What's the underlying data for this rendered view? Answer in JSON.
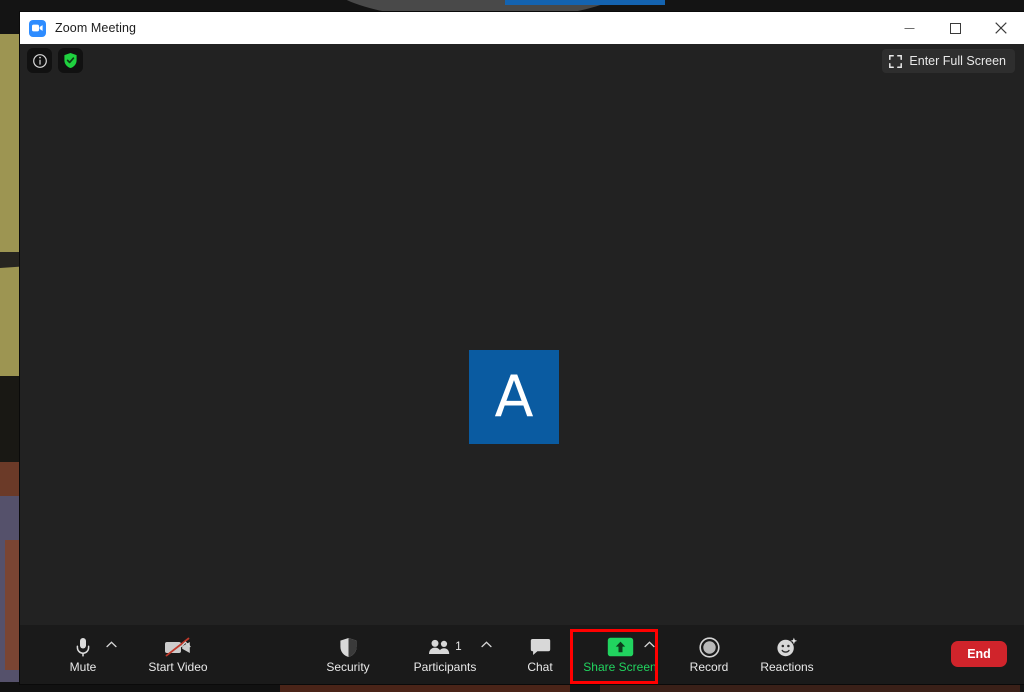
{
  "window": {
    "title": "Zoom Meeting",
    "logo_icon": "zoom-camera-icon",
    "controls": {
      "minimize_icon": "minimize-icon",
      "maximize_icon": "maximize-icon",
      "close_icon": "close-icon"
    }
  },
  "stage": {
    "info_icon": "info-circle-icon",
    "encryption_icon": "green-shield-check-icon",
    "full_screen": {
      "label": "Enter Full Screen",
      "icon": "expand-corners-icon"
    },
    "participant_tile": {
      "initial": "A",
      "background_color": "#0a5ba1"
    },
    "redacted_label": ""
  },
  "toolbar": {
    "items": [
      {
        "id": "mute",
        "label": "Mute",
        "icon": "microphone-icon",
        "has_caret": true,
        "state": "unmuted"
      },
      {
        "id": "video",
        "label": "Start Video",
        "icon": "camera-off-icon",
        "has_caret": true,
        "state": "video-off"
      },
      {
        "id": "security",
        "label": "Security",
        "icon": "shield-icon",
        "has_caret": false
      },
      {
        "id": "participants",
        "label": "Participants",
        "icon": "people-icon",
        "has_caret": true,
        "count": "1"
      },
      {
        "id": "chat",
        "label": "Chat",
        "icon": "speech-bubble-icon",
        "has_caret": false
      },
      {
        "id": "share",
        "label": "Share Screen",
        "icon": "share-arrow-up-icon",
        "has_caret": true,
        "highlighted": true
      },
      {
        "id": "record",
        "label": "Record",
        "icon": "record-circle-icon",
        "has_caret": false
      },
      {
        "id": "reactions",
        "label": "Reactions",
        "icon": "smiley-sparkle-icon",
        "has_caret": false
      }
    ],
    "end_button": {
      "label": "End"
    },
    "highlight_color": "#ff0000",
    "share_accent_color": "#21d45f",
    "end_color": "#d0242b"
  }
}
